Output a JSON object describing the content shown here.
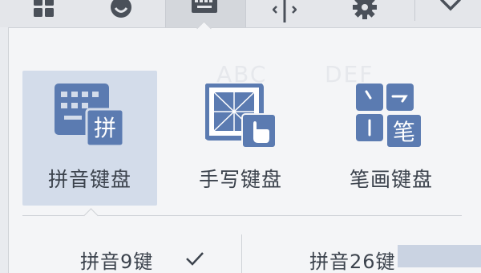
{
  "toolbar": {
    "buttons": [
      {
        "icon": "grid-icon"
      },
      {
        "icon": "emoji-icon"
      },
      {
        "icon": "keyboard-icon",
        "active": true
      },
      {
        "icon": "cursor-move-icon"
      },
      {
        "icon": "gear-icon"
      },
      {
        "icon": "chevron-down-icon"
      }
    ]
  },
  "keyboard_types": {
    "options": [
      {
        "label": "拼音键盘",
        "icon": "pinyin-keyboard-icon",
        "icon_text": "拼",
        "selected": true
      },
      {
        "label": "手写键盘",
        "icon": "handwriting-keyboard-icon",
        "selected": false
      },
      {
        "label": "笔画键盘",
        "icon": "stroke-keyboard-icon",
        "icon_text": "笔",
        "selected": false
      }
    ]
  },
  "layouts": {
    "options": [
      {
        "label": "拼音9键",
        "checked": true
      },
      {
        "label": "拼音26键",
        "checked": false
      }
    ]
  },
  "colors": {
    "accent": "#5b7bb1",
    "selected_bg": "#d3dcea",
    "text": "#3c434d"
  }
}
